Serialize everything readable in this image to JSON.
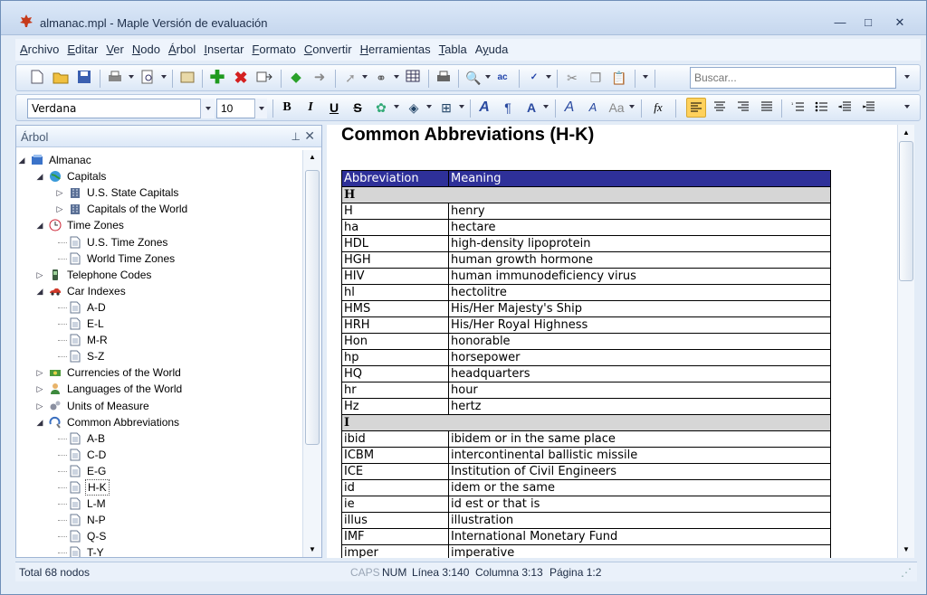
{
  "window": {
    "title": "almanac.mpl - Maple Versión de evaluación",
    "minimize": "—",
    "maximize": "□",
    "close": "✕"
  },
  "menubar": {
    "items": [
      {
        "label": "Archivo",
        "accel": "A"
      },
      {
        "label": "Editar",
        "accel": "E"
      },
      {
        "label": "Ver",
        "accel": "V"
      },
      {
        "label": "Nodo",
        "accel": "N"
      },
      {
        "label": "Árbol",
        "accel": "Á"
      },
      {
        "label": "Insertar",
        "accel": "I"
      },
      {
        "label": "Formato",
        "accel": "F"
      },
      {
        "label": "Convertir",
        "accel": "C"
      },
      {
        "label": "Herramientas",
        "accel": "H"
      },
      {
        "label": "Tabla",
        "accel": "T"
      },
      {
        "label": "Ayuda",
        "accel": "y"
      }
    ]
  },
  "toolbar": {
    "search_placeholder": "Buscar...",
    "font_name": "Verdana",
    "font_size": "10",
    "icons": [
      "new-document-icon",
      "open-folder-icon",
      "save-icon",
      "print-icon",
      "print-preview-icon",
      "properties-icon",
      "add-node-icon",
      "delete-node-icon",
      "move-node-icon",
      "back-arrow-icon",
      "forward-arrow-icon",
      "link-icon",
      "table-icon",
      "find-icon",
      "replace-icon",
      "spellcheck-icon",
      "cut-icon",
      "copy-icon",
      "paste-icon"
    ],
    "format_labels": {
      "bold": "B",
      "italic": "I",
      "underline": "U",
      "strike": "S",
      "fx": "fx"
    }
  },
  "tree": {
    "header": "Árbol",
    "pin": "📌",
    "close": "✕",
    "nodes": [
      {
        "label": "Almanac",
        "level": 0,
        "expanded": true,
        "icon": "book-icon"
      },
      {
        "label": "Capitals",
        "level": 1,
        "expanded": true,
        "icon": "globe-icon"
      },
      {
        "label": "U.S. State Capitals",
        "level": 2,
        "expanded": false,
        "icon": "building-icon"
      },
      {
        "label": "Capitals of the World",
        "level": 2,
        "expanded": false,
        "icon": "building-icon"
      },
      {
        "label": "Time Zones",
        "level": 1,
        "expanded": true,
        "icon": "clock-icon"
      },
      {
        "label": "U.S. Time Zones",
        "level": 2,
        "icon": "page-icon"
      },
      {
        "label": "World Time Zones",
        "level": 2,
        "icon": "page-icon"
      },
      {
        "label": "Telephone Codes",
        "level": 1,
        "expanded": false,
        "icon": "phone-icon"
      },
      {
        "label": "Car Indexes",
        "level": 1,
        "expanded": true,
        "icon": "car-icon"
      },
      {
        "label": "A-D",
        "level": 2,
        "icon": "page-icon"
      },
      {
        "label": "E-L",
        "level": 2,
        "icon": "page-icon"
      },
      {
        "label": "M-R",
        "level": 2,
        "icon": "page-icon"
      },
      {
        "label": "S-Z",
        "level": 2,
        "icon": "page-icon"
      },
      {
        "label": "Currencies of the World",
        "level": 1,
        "expanded": false,
        "icon": "money-icon"
      },
      {
        "label": "Languages of the World",
        "level": 1,
        "expanded": false,
        "icon": "person-icon"
      },
      {
        "label": "Units of Measure",
        "level": 1,
        "expanded": false,
        "icon": "gears-icon"
      },
      {
        "label": "Common Abbreviations",
        "level": 1,
        "expanded": true,
        "icon": "abbreviations-icon"
      },
      {
        "label": "A-B",
        "level": 2,
        "icon": "page-icon"
      },
      {
        "label": "C-D",
        "level": 2,
        "icon": "page-icon"
      },
      {
        "label": "E-G",
        "level": 2,
        "icon": "page-icon"
      },
      {
        "label": "H-K",
        "level": 2,
        "icon": "page-icon",
        "selected": true
      },
      {
        "label": "L-M",
        "level": 2,
        "icon": "page-icon"
      },
      {
        "label": "N-P",
        "level": 2,
        "icon": "page-icon"
      },
      {
        "label": "Q-S",
        "level": 2,
        "icon": "page-icon"
      },
      {
        "label": "T-Y",
        "level": 2,
        "icon": "page-icon"
      }
    ]
  },
  "document": {
    "title": "Common Abbreviations (H-K)",
    "headers": [
      "Abbreviation",
      "Meaning"
    ],
    "rows": [
      {
        "section": "H"
      },
      {
        "abbr": "H",
        "meaning": "henry"
      },
      {
        "abbr": "ha",
        "meaning": "hectare"
      },
      {
        "abbr": "HDL",
        "meaning": "high-density lipoprotein"
      },
      {
        "abbr": "HGH",
        "meaning": "human growth hormone"
      },
      {
        "abbr": "HIV",
        "meaning": "human immunodeficiency virus"
      },
      {
        "abbr": "hl",
        "meaning": "hectolitre"
      },
      {
        "abbr": "HMS",
        "meaning": "His/Her Majesty's Ship"
      },
      {
        "abbr": "HRH",
        "meaning": "His/Her Royal Highness"
      },
      {
        "abbr": "Hon",
        "meaning": "honorable"
      },
      {
        "abbr": "hp",
        "meaning": "horsepower"
      },
      {
        "abbr": "HQ",
        "meaning": "headquarters"
      },
      {
        "abbr": "hr",
        "meaning": "hour"
      },
      {
        "abbr": "Hz",
        "meaning": "hertz"
      },
      {
        "section": "I"
      },
      {
        "abbr": "ibid",
        "meaning": "ibidem or in the same place"
      },
      {
        "abbr": "ICBM",
        "meaning": "intercontinental ballistic missile"
      },
      {
        "abbr": "ICE",
        "meaning": "Institution of Civil Engineers"
      },
      {
        "abbr": "id",
        "meaning": "idem or the same"
      },
      {
        "abbr": "ie",
        "meaning": "id est or that is"
      },
      {
        "abbr": "illus",
        "meaning": "illustration"
      },
      {
        "abbr": "IMF",
        "meaning": "International Monetary Fund"
      },
      {
        "abbr": "imper",
        "meaning": "imperative"
      }
    ]
  },
  "status": {
    "nodes": "Total 68 nodos",
    "caps": "CAPS",
    "num": "NUM",
    "line": "Línea 3:140",
    "column": "Columna 3:13",
    "page": "Página 1:2"
  },
  "colors": {
    "header_bg": "#2e3099",
    "section_bg": "#d6d6d6",
    "accent": "#c6d7ee"
  }
}
